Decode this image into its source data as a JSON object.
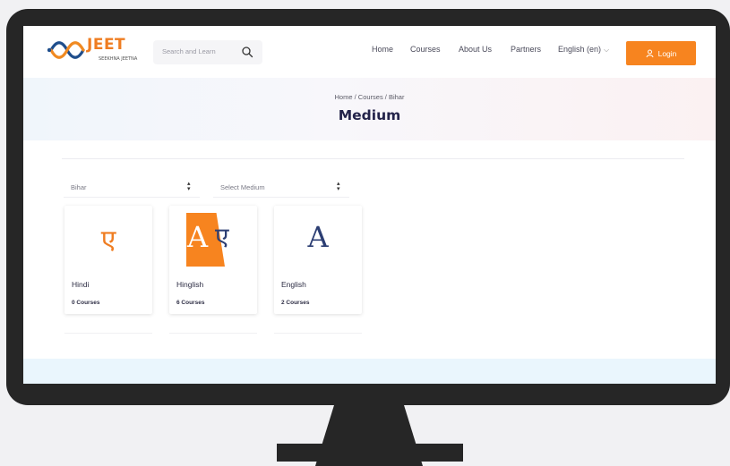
{
  "header": {
    "logo_text": "JEET",
    "logo_tagline": "SEEKHNA JEETNA",
    "search_placeholder": "Search and Learn",
    "nav": [
      "Home",
      "Courses",
      "About Us",
      "Partners",
      "English (en)"
    ],
    "login_label": "Login"
  },
  "hero": {
    "breadcrumb": "Home / Courses / Bihar",
    "title": "Medium"
  },
  "filters": {
    "state_select": "Bihar",
    "medium_select": "Select Medium"
  },
  "cards": [
    {
      "name": "Hindi",
      "count": "0 Courses",
      "glyph": "ए"
    },
    {
      "name": "Hinglish",
      "count": "6 Courses",
      "glyph_a": "A",
      "glyph_b": "ए"
    },
    {
      "name": "English",
      "count": "2 Courses",
      "glyph": "A"
    }
  ],
  "colors": {
    "accent": "#f7841f",
    "title": "#23234a",
    "english_glyph": "#2c3e73"
  },
  "icons": [
    "search-icon",
    "user-icon",
    "chevron-down-icon",
    "select-arrows-icon"
  ]
}
